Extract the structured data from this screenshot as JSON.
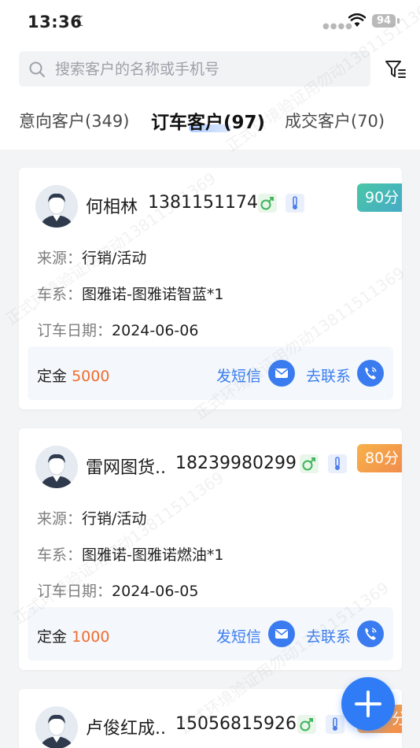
{
  "status_bar": {
    "time": "13:36",
    "battery": "94"
  },
  "search": {
    "placeholder": "搜索客户的名称或手机号"
  },
  "tabs": [
    {
      "label": "意向客户(349)",
      "active": false
    },
    {
      "label": "订车客户(97)",
      "active": true
    },
    {
      "label": "成交客户(70)",
      "active": false
    }
  ],
  "labels": {
    "source": "来源：",
    "series": "车系：",
    "order_date": "订车日期：",
    "deposit": "定金",
    "send_sms": "发短信",
    "contact": "去联系"
  },
  "customers": [
    {
      "name": "何相林",
      "phone": "13811511748",
      "score": "90分",
      "score_color": "#49c6a7",
      "source": "行销/活动",
      "series": "图雅诺-图雅诺智蓝*1",
      "order_date": "2024-06-06",
      "deposit": "5000"
    },
    {
      "name": "雷网图货..",
      "phone": "18239980299",
      "score": "80分",
      "score_color": "#f7a24a",
      "source": "行销/活动",
      "series": "图雅诺-图雅诺燃油*1",
      "order_date": "2024-06-05",
      "deposit": "1000"
    },
    {
      "name": "卢俊红成..",
      "phone": "15056815926",
      "score": "分",
      "score_color": "#f7a24a"
    }
  ],
  "watermark": {
    "text": "正式环境验证用勿动13811511369"
  },
  "colors": {
    "accent": "#3a7cf0",
    "deposit_amount": "#ef6c2e"
  },
  "icons": {
    "search": "search-icon",
    "filter": "filter-icon",
    "gender": "male-icon",
    "temperature": "thermometer-icon",
    "sms": "message-icon",
    "call": "phone-icon",
    "add": "plus-icon"
  }
}
